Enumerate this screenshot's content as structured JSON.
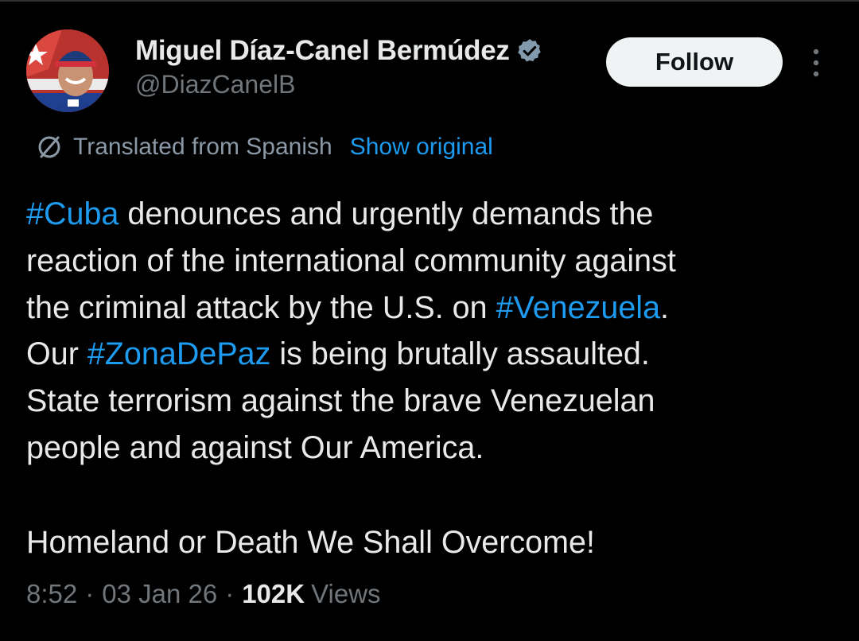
{
  "author": {
    "name": "Miguel Díaz-Canel Bermúdez",
    "handle": "@DiazCanelB",
    "verified_icon": "verified-badge-icon",
    "avatar_icon": "profile-photo"
  },
  "actions": {
    "follow_label": "Follow",
    "more_icon": "more-options-icon"
  },
  "translation": {
    "label": "Translated from Spanish",
    "show_original": "Show original",
    "icon": "globe-icon"
  },
  "tweet": {
    "lines": [
      {
        "hashtag": "#Cuba",
        "text": " denounces and urgently demands the"
      },
      {
        "text": "reaction of the international community against"
      },
      {
        "text": "the criminal attack by the U.S. on ",
        "hashtag": "#Venezuela",
        "tail": "."
      },
      {
        "prefix": "Our ",
        "hashtag": "#ZonaDePaz",
        "text": " is being brutally assaulted."
      },
      {
        "text": "State terrorism against the brave Venezuelan"
      },
      {
        "text": "people and against Our America."
      }
    ],
    "closing": "Homeland or Death We Shall Overcome!"
  },
  "meta": {
    "time": "8:52",
    "separator": "·",
    "date": "03 Jan 26",
    "views_count": "102K",
    "views_label": "Views"
  },
  "colors": {
    "background": "#000000",
    "text": "#e7e9ea",
    "muted": "#71767b",
    "link": "#1d9bf0",
    "verified": "#829aab"
  }
}
